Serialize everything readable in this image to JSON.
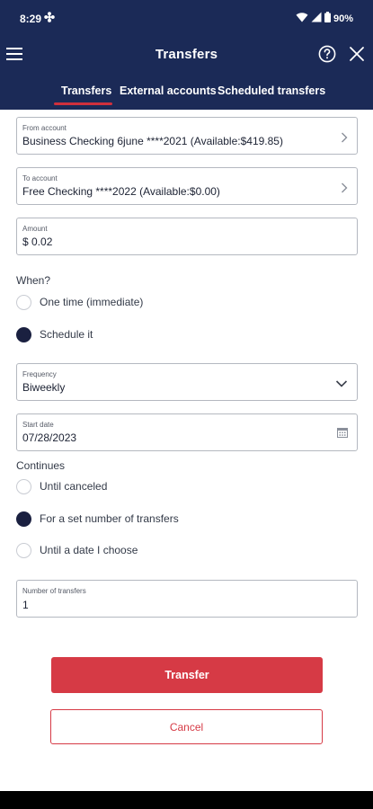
{
  "status_bar": {
    "time": "8:29",
    "battery_text": "90%",
    "icons": [
      "settings-fan-icon",
      "wifi-icon",
      "signal-icon",
      "battery-icon"
    ]
  },
  "app_bar": {
    "title": "Transfers",
    "icons": [
      "menu-icon",
      "help-icon",
      "close-icon"
    ]
  },
  "tabs": [
    {
      "label": "Transfers",
      "active": true
    },
    {
      "label": "External accounts",
      "active": false
    },
    {
      "label": "Scheduled transfers",
      "active": false
    }
  ],
  "form": {
    "from_account": {
      "label": "From account",
      "value": "Business Checking 6june ****2021 (Available:$419.85)"
    },
    "to_account": {
      "label": "To account",
      "value": "Free Checking ****2022 (Available:$0.00)"
    },
    "amount": {
      "label": "Amount",
      "value": "$ 0.02"
    },
    "when": {
      "title": "When?",
      "options": [
        {
          "label": "One time (immediate)",
          "selected": false
        },
        {
          "label": "Schedule it",
          "selected": true
        }
      ]
    },
    "frequency": {
      "label": "Frequency",
      "value": "Biweekly"
    },
    "start_date": {
      "label": "Start date",
      "value": "07/28/2023"
    },
    "continues": {
      "title": "Continues",
      "options": [
        {
          "label": "Until canceled",
          "selected": false
        },
        {
          "label": "For a set number of transfers",
          "selected": true
        },
        {
          "label": "Until a date I choose",
          "selected": false
        }
      ]
    },
    "number_of_transfers": {
      "label": "Number of transfers",
      "value": "1"
    }
  },
  "actions": {
    "transfer_label": "Transfer",
    "cancel_label": "Cancel"
  },
  "colors": {
    "header": "#1b2a57",
    "accent": "#d63a45",
    "radio_selected": "#1a2040"
  }
}
